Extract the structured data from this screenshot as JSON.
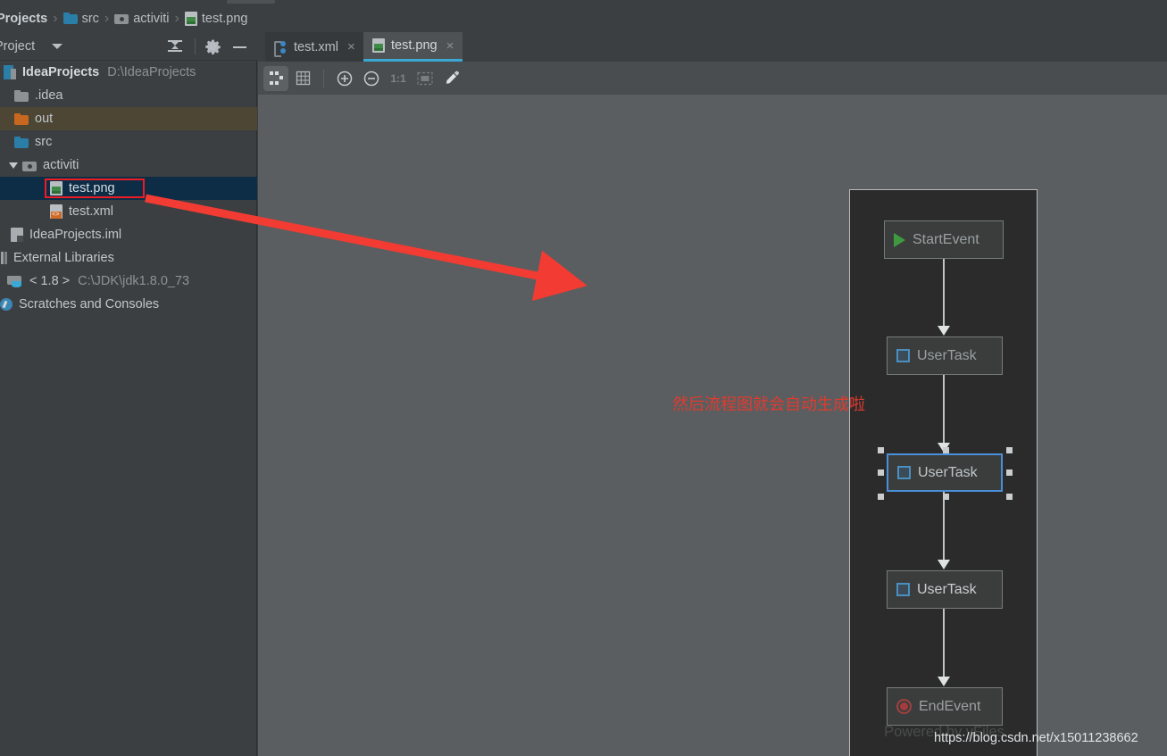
{
  "breadcrumb": {
    "name": "breadcrumb",
    "items": [
      {
        "label": "Projects",
        "icon": "none",
        "bold": true
      },
      {
        "label": "src",
        "icon": "folder-blue-icon",
        "bold": false
      },
      {
        "label": "activiti",
        "icon": "folder-package-icon",
        "bold": false
      },
      {
        "label": "test.png",
        "icon": "image-file-icon",
        "bold": false
      }
    ],
    "separator": "›"
  },
  "sidebar": {
    "title": "Project",
    "caret": "chevron-down-icon",
    "buttons": [
      {
        "name": "collapse-all-button",
        "icon": "collapse-all-icon"
      },
      {
        "name": "settings-button",
        "icon": "gear-icon"
      },
      {
        "name": "hide-button",
        "icon": "minus-icon"
      }
    ],
    "tree": [
      {
        "label": "IdeaProjects",
        "sublabel": "D:\\IdeaProjects",
        "icon": "module-icon",
        "indent": 0,
        "bold": true,
        "state": "normal"
      },
      {
        "label": ".idea",
        "sublabel": "",
        "icon": "folder-gray-icon",
        "indent": 1,
        "bold": false,
        "state": "normal"
      },
      {
        "label": "out",
        "sublabel": "",
        "icon": "folder-orange-icon",
        "indent": 1,
        "bold": false,
        "state": "highlight"
      },
      {
        "label": "src",
        "sublabel": "",
        "icon": "folder-blue-icon",
        "indent": 1,
        "bold": false,
        "state": "normal"
      },
      {
        "label": "activiti",
        "sublabel": "",
        "icon": "folder-package-icon",
        "indent": 1,
        "bold": false,
        "state": "expanded"
      },
      {
        "label": "test.png",
        "sublabel": "",
        "icon": "image-file-icon",
        "indent": 2,
        "bold": false,
        "state": "selected"
      },
      {
        "label": "test.xml",
        "sublabel": "",
        "icon": "xml-file-icon",
        "indent": 2,
        "bold": false,
        "state": "normal"
      },
      {
        "label": "IdeaProjects.iml",
        "sublabel": "",
        "icon": "iml-file-icon",
        "indent": 1,
        "bold": false,
        "state": "normal"
      },
      {
        "label": "External Libraries",
        "sublabel": "",
        "icon": "libraries-icon",
        "indent": 0,
        "bold": false,
        "state": "normal"
      },
      {
        "label": "< 1.8 >",
        "sublabel": "C:\\JDK\\jdk1.8.0_73",
        "icon": "jdk-icon",
        "indent": 1,
        "bold": false,
        "state": "normal"
      },
      {
        "label": "Scratches and Consoles",
        "sublabel": "",
        "icon": "scratches-icon",
        "indent": 0,
        "bold": false,
        "state": "normal"
      }
    ]
  },
  "editor": {
    "tabs": [
      {
        "label": "test.xml",
        "icon": "xml-tab-icon",
        "close": "×",
        "active": false
      },
      {
        "label": "test.png",
        "icon": "image-file-icon",
        "close": "×",
        "active": true
      }
    ],
    "image_toolbar": [
      {
        "name": "toggle-transparency-chessboard-button",
        "icon": "chessboard-icon",
        "label": "",
        "active": true,
        "disabled": false
      },
      {
        "name": "toggle-grid-button",
        "icon": "grid-icon",
        "label": "",
        "active": false,
        "disabled": false
      },
      {
        "name": "zoom-in-button",
        "icon": "zoom-in-icon",
        "label": "",
        "active": false,
        "disabled": false
      },
      {
        "name": "zoom-out-button",
        "icon": "zoom-out-icon",
        "label": "",
        "active": false,
        "disabled": false
      },
      {
        "name": "actual-size-button",
        "icon": "one-to-one-icon",
        "label": "1:1",
        "active": false,
        "disabled": true
      },
      {
        "name": "fit-to-window-button",
        "icon": "fit-screen-icon",
        "label": "",
        "active": false,
        "disabled": true
      },
      {
        "name": "color-picker-button",
        "icon": "eyedropper-icon",
        "label": "",
        "active": false,
        "disabled": false
      }
    ]
  },
  "diagram": {
    "watermark": "Powered by yFiles",
    "nodes": [
      {
        "label": "StartEvent",
        "icon": "start-event-play-icon",
        "selected": false
      },
      {
        "label": "UserTask",
        "icon": "user-task-square-icon",
        "selected": false
      },
      {
        "label": "UserTask",
        "icon": "user-task-square-icon",
        "selected": true
      },
      {
        "label": "UserTask",
        "icon": "user-task-square-icon",
        "selected": false
      },
      {
        "label": "EndEvent",
        "icon": "end-event-circle-icon",
        "selected": false
      }
    ]
  },
  "annotations": {
    "callout_text": "然后流程图就会自动生成啦",
    "callout_color": "#e03b2f",
    "highlight_box_color": "#ec1c24",
    "arrow_color": "#f23b33"
  },
  "footer": {
    "url": "https://blog.csdn.net/x15011238662"
  }
}
